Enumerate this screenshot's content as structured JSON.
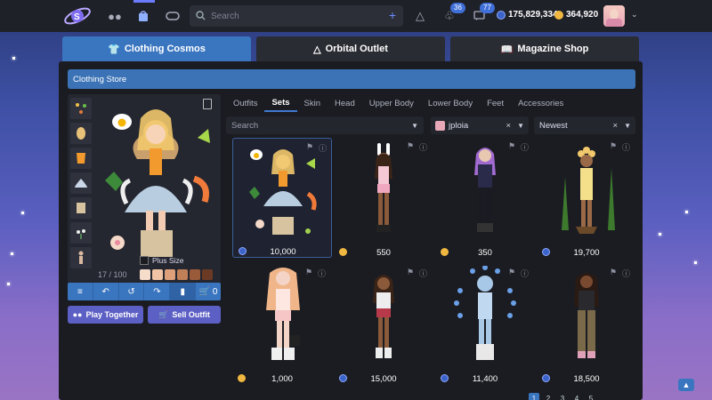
{
  "topbar": {
    "search_placeholder": "Search",
    "notifications_count": "36",
    "messages_count": "77",
    "blue_currency": "175,829,334",
    "gold_currency": "364,920"
  },
  "shop_tabs": [
    {
      "label": "Clothing Cosmos",
      "icon": "shirt-icon"
    },
    {
      "label": "Orbital Outlet",
      "icon": "hanger-icon"
    },
    {
      "label": "Magazine Shop",
      "icon": "magazine-icon"
    }
  ],
  "store_title": "Clothing Store",
  "counter": "17 / 100",
  "plus_size_label": "Plus Size",
  "cart_count": "0",
  "play_together_label": "Play Together",
  "sell_outfit_label": "Sell Outfit",
  "category_tabs": [
    "Outfits",
    "Sets",
    "Skin",
    "Head",
    "Upper Body",
    "Lower Body",
    "Feet",
    "Accessories"
  ],
  "active_category": "Sets",
  "filters": {
    "search_placeholder": "Search",
    "creator": "jploia",
    "sort": "Newest"
  },
  "items": [
    {
      "price": "10,000",
      "currency": "blue"
    },
    {
      "price": "550",
      "currency": "gold"
    },
    {
      "price": "350",
      "currency": "gold"
    },
    {
      "price": "19,700",
      "currency": "blue"
    },
    {
      "price": "1,000",
      "currency": "gold"
    },
    {
      "price": "15,000",
      "currency": "blue"
    },
    {
      "price": "11,400",
      "currency": "blue"
    },
    {
      "price": "18,500",
      "currency": "blue"
    }
  ],
  "pagination": [
    "1",
    "2",
    "3",
    "4",
    "5"
  ],
  "colors": {
    "accent": "#3a76c0",
    "purple_button": "#5c5fc4",
    "panel": "#1b1c21",
    "blue_coin": "#3b63c9",
    "gold_coin": "#f0b840"
  }
}
